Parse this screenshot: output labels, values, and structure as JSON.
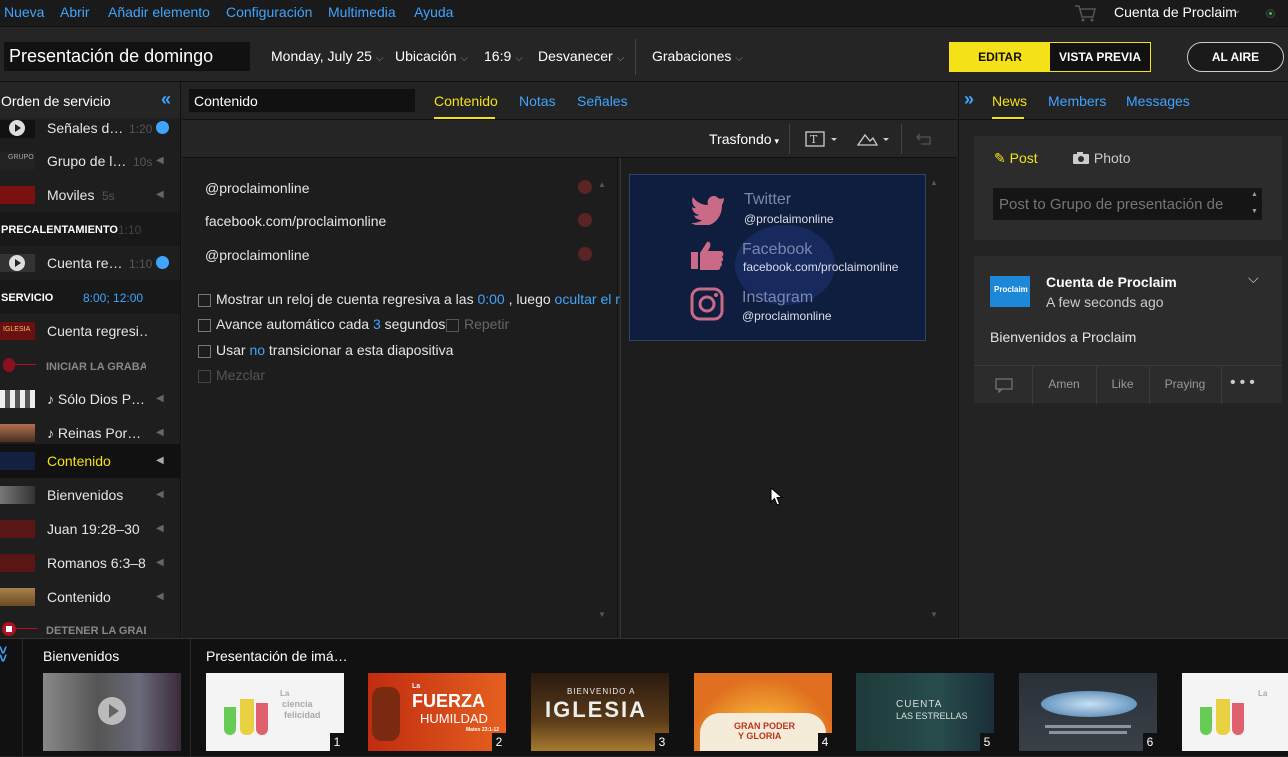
{
  "menu": {
    "items": [
      "Nueva",
      "Abrir",
      "Añadir elemento",
      "Configuración",
      "Multimedia",
      "Ayuda"
    ],
    "account": "Cuenta de Proclaim"
  },
  "toolbar": {
    "title": "Presentación de domingo",
    "date": "Monday, July 25",
    "location": "Ubicación",
    "ratio": "16:9",
    "transition": "Desvanecer",
    "recordings": "Grabaciones",
    "edit": "EDITAR",
    "preview": "VISTA PREVIA",
    "live": "AL AIRE"
  },
  "sidebar": {
    "title": "Orden de servicio",
    "items": [
      {
        "label": "Señales d…",
        "dur": "1:20"
      },
      {
        "label": "Grupo de l…",
        "dur": "10s"
      },
      {
        "label": "Moviles",
        "dur": "5s"
      },
      {
        "label": "PRECALENTAMIENTO",
        "dur": "1:10"
      },
      {
        "label": "Cuenta re…",
        "dur": "1:10"
      },
      {
        "label": "SERVICIO",
        "dur": "8:00; 12:00"
      },
      {
        "label": "Cuenta regresi…"
      },
      {
        "label": "INICIAR LA GRABACIÓN"
      },
      {
        "label": "♪  Sólo Dios P…"
      },
      {
        "label": "♪  Reinas Por…"
      },
      {
        "label": "Contenido"
      },
      {
        "label": "Bienvenidos"
      },
      {
        "label": "Juan 19:28–30"
      },
      {
        "label": "Romanos 6:3–8"
      },
      {
        "label": "Contenido"
      },
      {
        "label": "DETENER LA GRABACIÓN"
      }
    ]
  },
  "editor": {
    "content_name": "Contenido",
    "tabs": [
      "Contenido",
      "Notas",
      "Señales"
    ],
    "background": "Trasfondo",
    "social": [
      "@proclaimonline",
      "facebook.com/proclaimonline",
      "@proclaimonline"
    ],
    "options": {
      "countdown_a": "Mostrar un reloj de cuenta regresiva a las",
      "countdown_time": "0:00",
      "countdown_b": ", luego",
      "countdown_c": "ocultar el re",
      "advance_a": "Avance automático cada",
      "advance_n": "3",
      "advance_b": "segundos",
      "repeat": "Repetir",
      "transition_a": "Usar",
      "transition_b": "no",
      "transition_c": "transicionar a esta diapositiva",
      "shuffle": "Mezclar"
    }
  },
  "preview": {
    "twitter": "Twitter",
    "twitter_handle": "@proclaimonline",
    "facebook": "Facebook",
    "facebook_handle": "facebook.com/proclaimonline",
    "instagram": "Instagram",
    "instagram_handle": "@proclaimonline"
  },
  "news": {
    "tabs": [
      "News",
      "Members",
      "Messages"
    ],
    "post": "Post",
    "photo": "Photo",
    "post_placeholder": "Post to Grupo de presentación de",
    "feed_author": "Cuenta de Proclaim",
    "feed_time": "A few seconds ago",
    "feed_text": "Bienvenidos a Proclaim",
    "feed_logo": "Proclaim",
    "actions": [
      "Amen",
      "Like",
      "Praying"
    ]
  },
  "bottom": {
    "left_label": "Bienvenidos",
    "right_label": "Presentación de imá…",
    "thumbs": [
      {
        "n": "1",
        "text_a": "La",
        "text_b": "ciencia",
        "text_c": "felicidad"
      },
      {
        "n": "2",
        "text_a": "La",
        "text_b": "FUERZA",
        "text_c": "HUMILDAD",
        "text_d": "Mateo 23:1-12"
      },
      {
        "n": "3",
        "text_a": "BIENVENIDO A",
        "text_b": "IGLESIA"
      },
      {
        "n": "4",
        "text_a": "GRAN PODER",
        "text_b": "Y GLORIA"
      },
      {
        "n": "5",
        "text_a": "CUENTA",
        "text_b": "LAS ESTRELLAS"
      },
      {
        "n": "6"
      },
      {
        "text_a": "La"
      }
    ]
  }
}
